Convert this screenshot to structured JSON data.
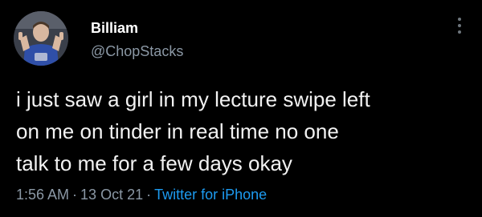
{
  "author": {
    "display_name": "Billiam",
    "handle": "@ChopStacks"
  },
  "tweet": {
    "lines": [
      "i just saw a girl in my lecture swipe left",
      "on me on tinder in real time no one",
      "talk to me for a few days okay"
    ],
    "time": "1:56 AM",
    "date": "13 Oct 21",
    "source": "Twitter for iPhone",
    "separator": "·"
  },
  "icons": {
    "avatar": "profile-photo",
    "more": "more-vertical-icon"
  },
  "colors": {
    "background": "#000000",
    "text": "#e7e9ea",
    "muted": "#8b98a5",
    "link": "#1d9bf0"
  }
}
